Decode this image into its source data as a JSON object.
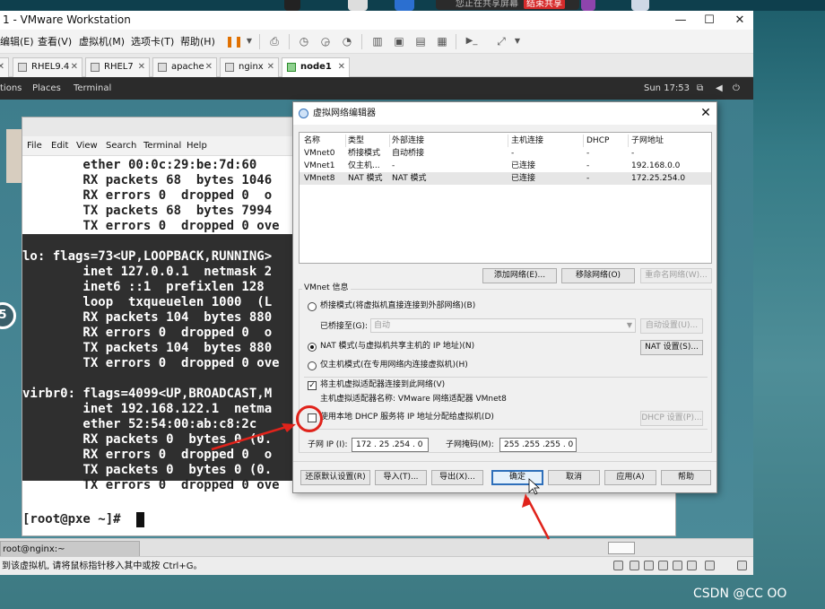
{
  "host": {
    "notice": "您正在共享屏幕",
    "share_end": "结束共享"
  },
  "window": {
    "title": "1 - VMware Workstation"
  },
  "menu": [
    "编辑(E)",
    "查看(V)",
    "虚拟机(M)",
    "选项卡(T)",
    "帮助(H)"
  ],
  "tabs": [
    {
      "label": "",
      "active": false
    },
    {
      "label": "RHEL9.4",
      "active": false
    },
    {
      "label": "RHEL7",
      "active": false
    },
    {
      "label": "apache",
      "active": false
    },
    {
      "label": "nginx",
      "active": false
    },
    {
      "label": "node1",
      "active": true
    }
  ],
  "guest": {
    "menu": [
      "tions",
      "Places",
      "Terminal"
    ],
    "clock": "Sun 17:53",
    "circle_label": "5"
  },
  "terminal": {
    "menu": [
      "File",
      "Edit",
      "View",
      "Search",
      "Terminal",
      "Help"
    ],
    "lines": [
      "        ether 00:0c:29:be:7d:60",
      "        RX packets 68  bytes 1046",
      "        RX errors 0  dropped 0  o",
      "        TX packets 68  bytes 7994",
      "        TX errors 0  dropped 0 ove",
      "",
      "lo: flags=73<UP,LOOPBACK,RUNNING>",
      "        inet 127.0.0.1  netmask 2",
      "        inet6 ::1  prefixlen 128",
      "        loop  txqueuelen 1000  (L",
      "        RX packets 104  bytes 880",
      "        RX errors 0  dropped 0  o",
      "        TX packets 104  bytes 880",
      "        TX errors 0  dropped 0 ove",
      "",
      "virbr0: flags=4099<UP,BROADCAST,M",
      "        inet 192.168.122.1  netma",
      "        ether 52:54:00:ab:c8:2c",
      "        RX packets 0  bytes 0 (0.",
      "        RX errors 0  dropped 0  o",
      "        TX packets 0  bytes 0 (0.",
      "        TX errors 0  dropped 0 ove",
      "",
      "[root@pxe ~]# "
    ]
  },
  "dialog": {
    "title": "虚拟网络编辑器",
    "columns": [
      "名称",
      "类型",
      "外部连接",
      "主机连接",
      "DHCP",
      "子网地址"
    ],
    "rows": [
      [
        "VMnet0",
        "桥接模式",
        "自动桥接",
        "-",
        "-",
        "-"
      ],
      [
        "VMnet1",
        "仅主机...",
        "-",
        "已连接",
        "-",
        "192.168.0.0"
      ],
      [
        "VMnet8",
        "NAT 模式",
        "NAT 模式",
        "已连接",
        "-",
        "172.25.254.0"
      ]
    ],
    "add_network": "添加网络(E)...",
    "remove_network": "移除网络(O)",
    "rename_network": "重命名网络(W)...",
    "vmnet_info": "VMnet 信息",
    "bridge_mode": "桥接模式(将虚拟机直接连接到外部网络)(B)",
    "bridge_to_label": "已桥接至(G):",
    "bridge_to_value": "自动",
    "auto_settings": "自动设置(U)...",
    "nat_mode": "NAT 模式(与虚拟机共享主机的 IP 地址)(N)",
    "nat_settings": "NAT 设置(S)...",
    "host_only": "仅主机模式(在专用网络内连接虚拟机)(H)",
    "connect_adapter": "将主机虚拟适配器连接到此网络(V)",
    "adapter_name": "主机虚拟适配器名称: VMware 网络适配器 VMnet8",
    "use_dhcp": "使用本地 DHCP 服务将 IP 地址分配给虚拟机(D)",
    "dhcp_settings": "DHCP 设置(P)...",
    "subnet_ip_label": "子网 IP (I):",
    "subnet_ip": "172 . 25 .254 . 0",
    "subnet_mask_label": "子网掩码(M):",
    "subnet_mask": "255 .255 .255 . 0",
    "restore": "还原默认设置(R)",
    "import": "导入(T)...",
    "export": "导出(X)...",
    "ok": "确定",
    "cancel": "取消",
    "apply": "应用(A)",
    "help": "帮助"
  },
  "bottom": {
    "vm_tab": "root@nginx:~",
    "status": "到该虚拟机, 请将鼠标指针移入其中或按 Ctrl+G。"
  },
  "watermark": "CSDN @CC OO",
  "colors": {
    "accent": "#2e6fba",
    "annotation": "#e0231b",
    "terminal_selection": "#2f2f2f"
  }
}
